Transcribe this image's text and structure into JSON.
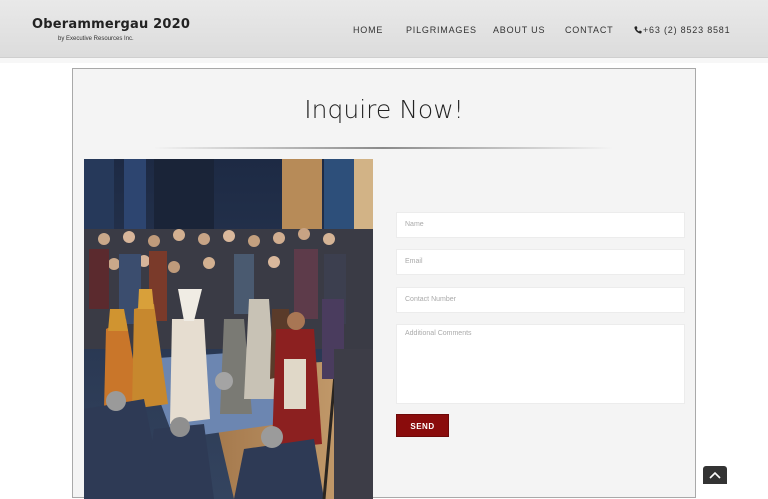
{
  "header": {
    "logo_title": "Oberammergau 2020",
    "logo_subtitle": "by Executive Resources Inc.",
    "nav": [
      {
        "label": "HOME"
      },
      {
        "label": "PILGRIMAGES"
      },
      {
        "label": "ABOUT US"
      },
      {
        "label": "CONTACT"
      }
    ],
    "phone": "+63 (2) 8523 8581",
    "phone_icon": "phone-icon"
  },
  "main": {
    "title": "Inquire Now!",
    "photo_icon": "passion-play-crowd-photo",
    "form": {
      "name_placeholder": "Name",
      "email_placeholder": "Email",
      "contact_placeholder": "Contact Number",
      "comments_placeholder": "Additional Comments",
      "send_label": "SEND"
    }
  },
  "colors": {
    "accent": "#8a0c0c",
    "header_bg": "#e3e3e3",
    "card_bg": "#f4f4f4"
  }
}
